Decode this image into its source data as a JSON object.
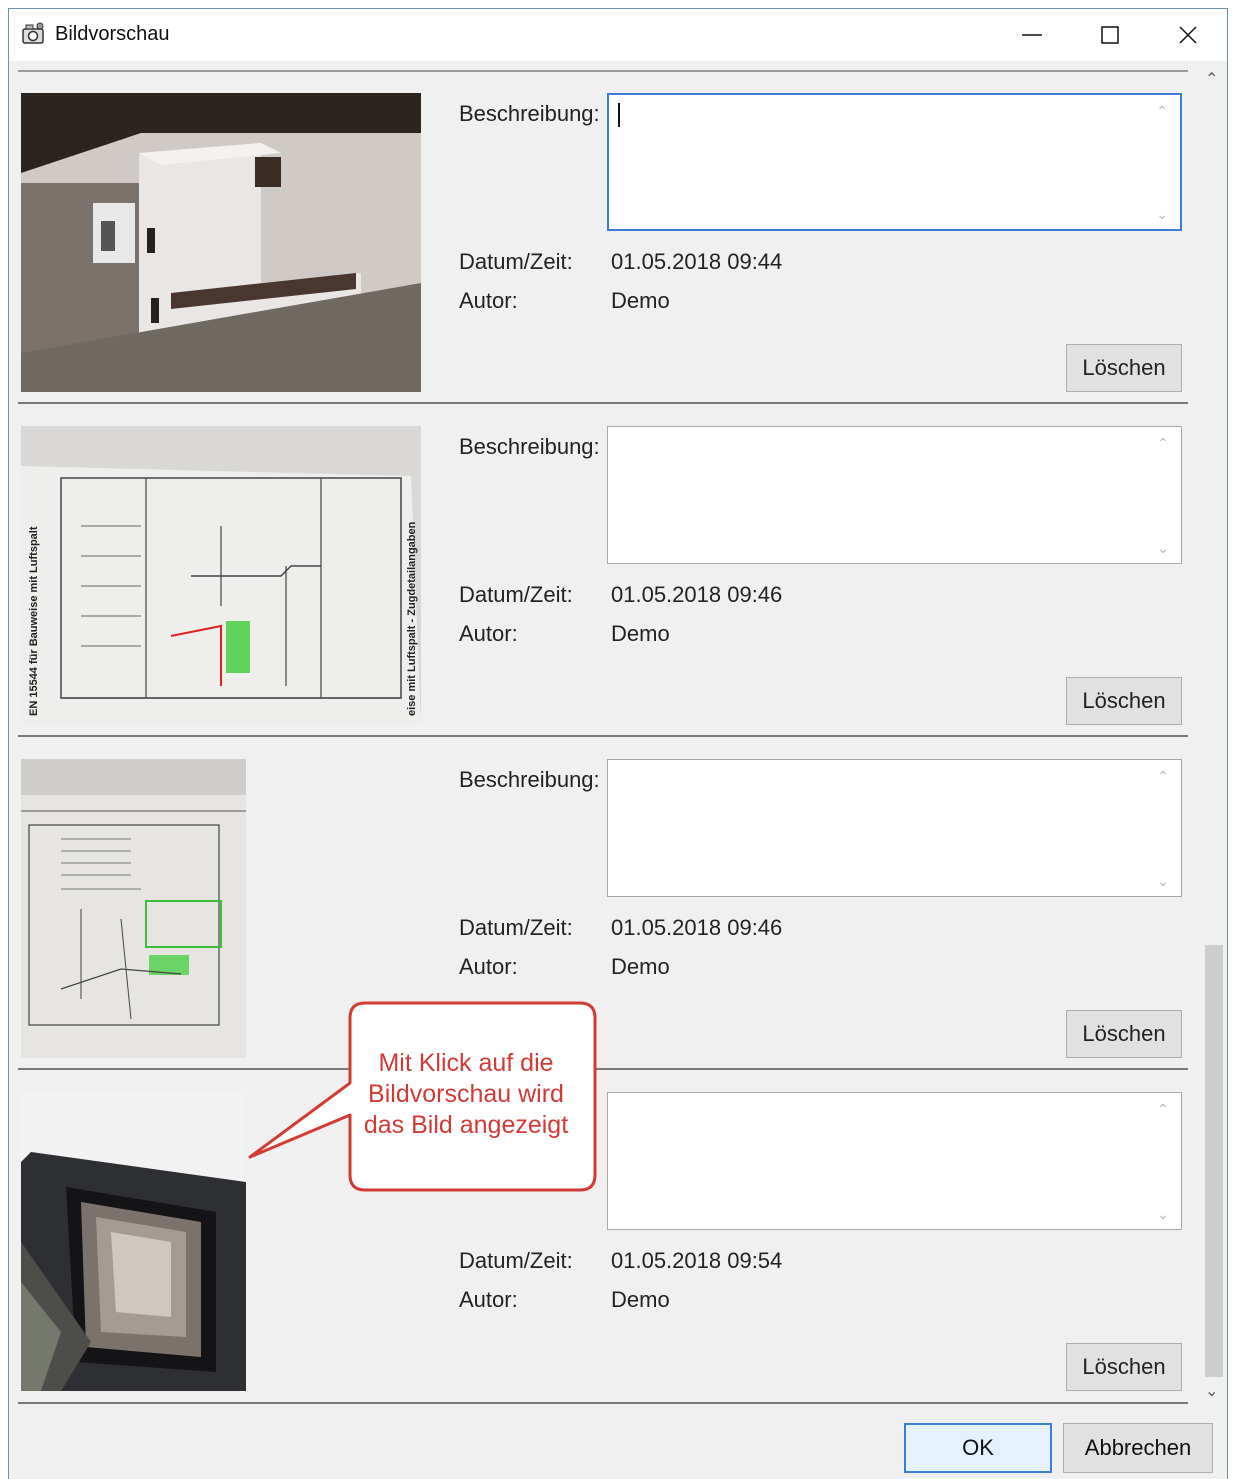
{
  "window": {
    "title": "Bildvorschau",
    "app_icon": "camera-app-icon",
    "controls": [
      "minimize-icon",
      "maximize-icon",
      "close-icon"
    ]
  },
  "labels": {
    "description": "Beschreibung:",
    "datetime": "Datum/Zeit:",
    "author": "Autor:",
    "delete": "Löschen"
  },
  "entries": [
    {
      "description": "",
      "datetime": "01.05.2018 09:44",
      "author": "Demo",
      "image": "stove-room-photo"
    },
    {
      "description": "",
      "datetime": "01.05.2018 09:46",
      "author": "Demo",
      "image": "technical-drawing-landscape"
    },
    {
      "description": "",
      "datetime": "01.05.2018 09:46",
      "author": "Demo",
      "image": "technical-drawing-portrait"
    },
    {
      "description": "",
      "datetime": "01.05.2018 09:54",
      "author": "Demo",
      "image": "chimney-door-photo"
    }
  ],
  "callout": {
    "lines": [
      "Mit Klick auf die",
      "Bildvorschau wird",
      "das Bild angezeigt"
    ],
    "border_color": "#d23b35",
    "text_color": "#d23b35"
  },
  "footer": {
    "ok_label": "OK",
    "cancel_label": "Abbrechen"
  },
  "colors": {
    "accent": "#3c7fd1",
    "window_bg": "#f0f0f0"
  }
}
